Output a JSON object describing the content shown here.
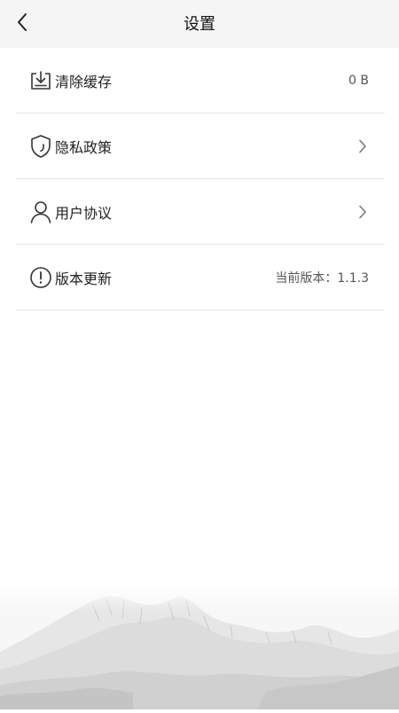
{
  "header": {
    "title": "设置",
    "back_icon": "chevron-left-icon"
  },
  "settings": {
    "items": [
      {
        "id": "clear-cache",
        "label": "清除缓存",
        "value": "0 B",
        "icon": "download-tray-icon"
      },
      {
        "id": "privacy-policy",
        "label": "隐私政策",
        "icon": "shield-icon",
        "chevron": "chevron-right-icon"
      },
      {
        "id": "user-agreement",
        "label": "用户协议",
        "icon": "person-icon",
        "chevron": "chevron-right-icon"
      },
      {
        "id": "version-update",
        "label": "版本更新",
        "value": "当前版本：1.1.3",
        "icon": "alert-circle-icon"
      }
    ]
  },
  "colors": {
    "header_bg": "#f5f5f5",
    "divider": "#e6e6e6",
    "text": "#222222",
    "secondary_text": "#555555"
  }
}
